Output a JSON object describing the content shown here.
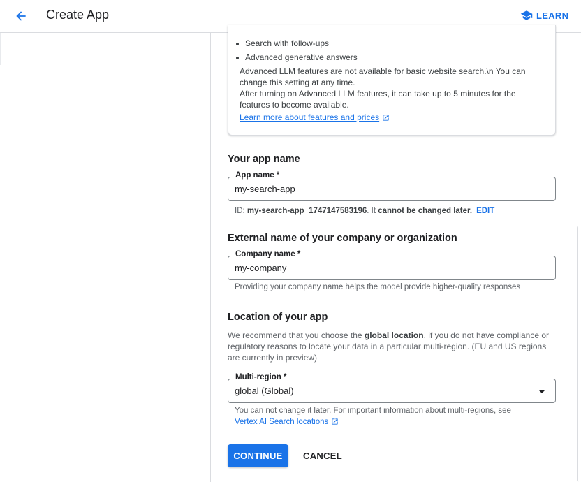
{
  "header": {
    "title": "Create App",
    "learn_label": "LEARN",
    "accent": "#1a73e8"
  },
  "features_card": {
    "bullets": [
      "Search with follow-ups",
      "Advanced generative answers"
    ],
    "note_1": "Advanced LLM features are not available for basic website search.\\n You can change this setting at any time.",
    "note_2": "After turning on Advanced LLM features, it can take up to 5 minutes for the features to become available.",
    "learn_more_link": "Learn more about features and prices"
  },
  "app_name": {
    "section_title": "Your app name",
    "label": "App name *",
    "value": "my-search-app",
    "id_prefix": "ID: ",
    "id_value": "my-search-app_1747147583196",
    "id_suffix": ". It ",
    "id_warning": "cannot be changed later.",
    "edit_label": "EDIT"
  },
  "company": {
    "section_title": "External name of your company or organization",
    "label": "Company name *",
    "value": "my-company",
    "helper": "Providing your company name helps the model provide higher-quality responses"
  },
  "location": {
    "section_title": "Location of your app",
    "desc_before": "We recommend that you choose the ",
    "desc_bold": "global location",
    "desc_after": ", if you do not have compliance or regulatory reasons to locate your data in a particular multi-region. (EU and US regions are currently in preview)",
    "label": "Multi-region *",
    "value": "global (Global)",
    "helper": "You can not change it later. For important information about multi-regions, see",
    "helper_link": "Vertex AI Search locations"
  },
  "actions": {
    "continue_label": "CONTINUE",
    "cancel_label": "CANCEL"
  }
}
